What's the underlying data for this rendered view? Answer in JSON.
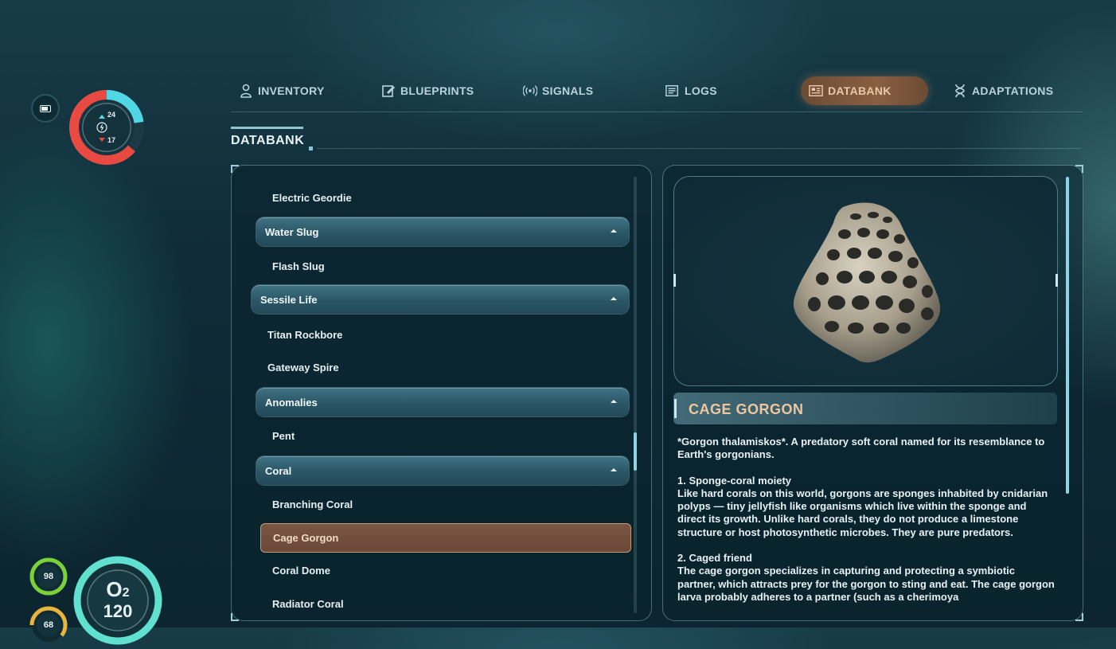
{
  "hud": {
    "battery_icon": "battery-icon",
    "gauge_top_value": "24",
    "gauge_bottom_value": "17",
    "health_value": "98",
    "oxygen_label": "O",
    "oxygen_sub": "2",
    "oxygen_value": "120",
    "food_value": "68",
    "colors": {
      "health_ring": "#e84a42",
      "cyan_ring": "#4fd7e6",
      "green_ring": "#7ad13a",
      "o2_ring": "#5fe0d0",
      "food_ring": "#e8b43a"
    }
  },
  "tabs": [
    {
      "label": "INVENTORY",
      "icon": "person-icon"
    },
    {
      "label": "BLUEPRINTS",
      "icon": "blueprint-icon"
    },
    {
      "label": "SIGNALS",
      "icon": "signal-icon"
    },
    {
      "label": "LOGS",
      "icon": "logs-icon"
    },
    {
      "label": "DATABANK",
      "icon": "databank-icon",
      "active": true
    },
    {
      "label": "ADAPTATIONS",
      "icon": "dna-icon"
    }
  ],
  "section": {
    "title": "DATABANK"
  },
  "list": {
    "entries": [
      {
        "label": "Electric Geordie"
      },
      {
        "label": "Water Slug",
        "category": true
      },
      {
        "label": "Flash Slug"
      },
      {
        "label": "Sessile Life",
        "category": true
      },
      {
        "label": "Titan Rockbore"
      },
      {
        "label": "Gateway Spire"
      },
      {
        "label": "Anomalies",
        "category": true
      },
      {
        "label": "Pent"
      },
      {
        "label": "Coral",
        "category": true
      },
      {
        "label": "Branching Coral"
      },
      {
        "label": "Cage Gorgon",
        "selected": true
      },
      {
        "label": "Coral Dome"
      },
      {
        "label": "Radiator Coral"
      }
    ]
  },
  "detail": {
    "title": "CAGE GORGON",
    "paragraphs": [
      "*Gorgon thalamiskos*. A predatory soft coral named for its resemblance to Earth's gorgonians.",
      "1. Sponge-coral moiety",
      "Like hard corals on this world, gorgons are sponges inhabited by cnidarian polyps — tiny jellyfish like organisms which live within the sponge and direct its growth. Unlike hard corals, they do not produce a limestone structure or host photosynthetic microbes. They are pure predators.",
      "2. Caged friend",
      "The cage gorgon specializes in capturing and protecting a symbiotic partner, which attracts prey for the gorgon to sting and eat. The cage gorgon larva probably adheres to a partner (such as a cherimoya"
    ]
  }
}
